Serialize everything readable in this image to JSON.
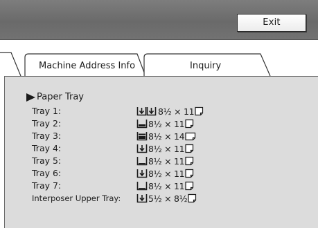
{
  "toolbar": {
    "exit_label": "Exit"
  },
  "tabs": [
    {
      "label": "Machine Address Info"
    },
    {
      "label": "Inquiry"
    }
  ],
  "section": {
    "title": "Paper Tray"
  },
  "trays": [
    {
      "label": "Tray 1:",
      "icon": "double-feed-tray-icon",
      "size": "8½ × 11"
    },
    {
      "label": "Tray 2:",
      "icon": "tray-half-full-icon",
      "size": "8½ × 11"
    },
    {
      "label": "Tray 3:",
      "icon": "tray-full-icon",
      "size": "8½ × 14"
    },
    {
      "label": "Tray 4:",
      "icon": "tray-feed-arrow-icon",
      "size": "8½ × 11"
    },
    {
      "label": "Tray 5:",
      "icon": "tray-empty-icon",
      "size": "8½ × 11"
    },
    {
      "label": "Tray 6:",
      "icon": "tray-feed-arrow-icon",
      "size": "8½ × 11"
    },
    {
      "label": "Tray 7:",
      "icon": "tray-empty-icon",
      "size": "8½ × 11"
    },
    {
      "label": "Interposer Upper Tray:",
      "icon": "tray-feed-arrow-icon",
      "size": "5½ × 8½"
    }
  ],
  "orientation_icon": "paper-orientation-icon"
}
